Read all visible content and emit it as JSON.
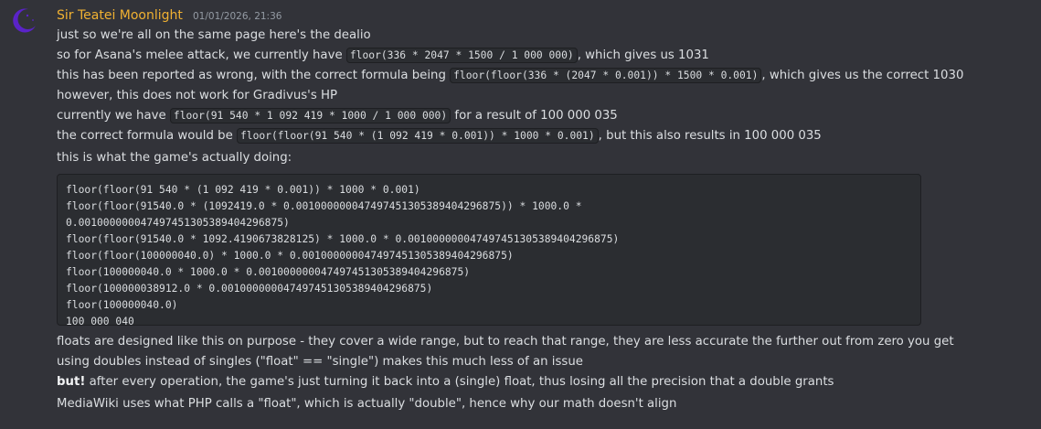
{
  "message": {
    "username": "Sir Teatei Moonlight",
    "timestamp": "01/01/2026, 21:36",
    "avatar_icon": "crescent-moon-icon",
    "colors": {
      "username": "#f0b132",
      "avatar": "#5a23c8",
      "background": "#323339"
    }
  },
  "lines": {
    "l1": "just so we're all on the same page here's the dealio",
    "l2_pre": "so for Asana's melee attack, we currently have ",
    "l2_code": "floor(336 * 2047 * 1500 / 1 000 000)",
    "l2_post": ", which gives us 1031",
    "l3_pre": "this has been reported as wrong, with the correct formula being ",
    "l3_code": "floor(floor(336 * (2047 * 0.001)) * 1500 * 0.001)",
    "l3_post": ", which gives us the correct 1030",
    "l4": "however, this does not work for Gradivus's HP",
    "l5_pre": "currently we have ",
    "l5_code": "floor(91 540 * 1 092 419 * 1000 / 1 000 000)",
    "l5_post": " for a result of 100 000 035",
    "l6_pre": "the correct formula would be ",
    "l6_code": "floor(floor(91 540 * (1 092 419 * 0.001)) * 1000 * 0.001)",
    "l6_post": ", but this also results in 100 000 035",
    "l7": "this is what the game's actually doing:",
    "l8": "floats are designed like this on purpose - they cover a wide range, but to reach that range, they are less accurate the further out from zero you get",
    "l9": "using doubles instead of singles (\"float\" == \"single\") makes this much less of an issue",
    "l10_bold": "but!",
    "l10_post": " after every operation, the game's just turning it back into a (single) float, thus losing all the precision that a double grants",
    "l11": "MediaWiki uses what PHP calls a \"float\", which is actually \"double\", hence why our math doesn't align"
  },
  "codeblock": [
    "floor(floor(91 540 * (1 092 419 * 0.001)) * 1000 * 0.001)",
    "floor(floor(91540.0 * (1092419.0 * 0.001000000047497451305389404296875)) * 1000.0 *",
    "0.001000000047497451305389404296875)",
    "floor(floor(91540.0 * 1092.4190673828125) * 1000.0 * 0.001000000047497451305389404296875)",
    "floor(floor(100000040.0) * 1000.0 * 0.001000000047497451305389404296875)",
    "floor(100000040.0 * 1000.0 * 0.001000000047497451305389404296875)",
    "floor(100000038912.0 * 0.001000000047497451305389404296875)",
    "floor(100000040.0)",
    "100 000 040"
  ]
}
